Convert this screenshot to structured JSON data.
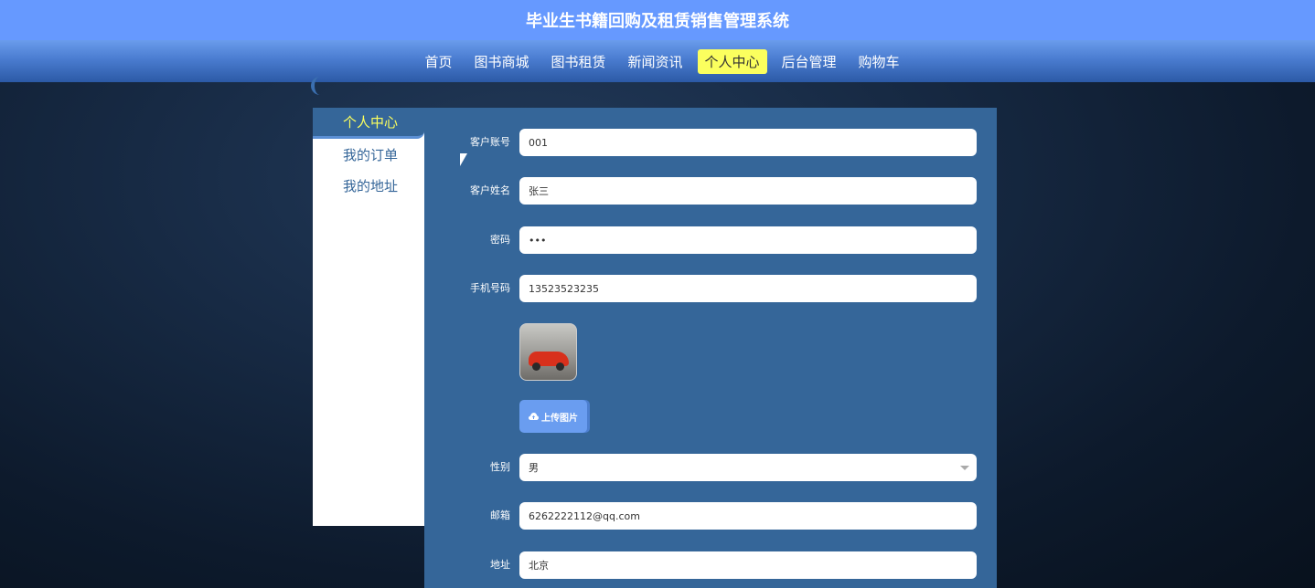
{
  "header": {
    "title": "毕业生书籍回购及租赁销售管理系统"
  },
  "nav": {
    "items": [
      {
        "label": "首页"
      },
      {
        "label": "图书商城"
      },
      {
        "label": "图书租赁"
      },
      {
        "label": "新闻资讯"
      },
      {
        "label": "个人中心"
      },
      {
        "label": "后台管理"
      },
      {
        "label": "购物车"
      }
    ],
    "active": "个人中心"
  },
  "sidebar": {
    "title": "个人中心",
    "items": [
      {
        "label": "我的订单"
      },
      {
        "label": "我的地址"
      }
    ]
  },
  "form": {
    "account_label": "客户账号",
    "account_value": "001",
    "name_label": "客户姓名",
    "name_value": "张三",
    "password_label": "密码",
    "password_value": "•••",
    "phone_label": "手机号码",
    "phone_value": "13523523235",
    "upload_label": "上传图片",
    "gender_label": "性别",
    "gender_value": "男",
    "email_label": "邮箱",
    "email_value": "6262222112@qq.com",
    "address_label": "地址",
    "address_value": "北京"
  },
  "colors": {
    "title_bar": "#6699ff",
    "panel": "#356699",
    "active_nav": "#fbff5e"
  },
  "icons": {
    "upload": "cloud-upload-icon",
    "select": "chevron-down-icon"
  }
}
